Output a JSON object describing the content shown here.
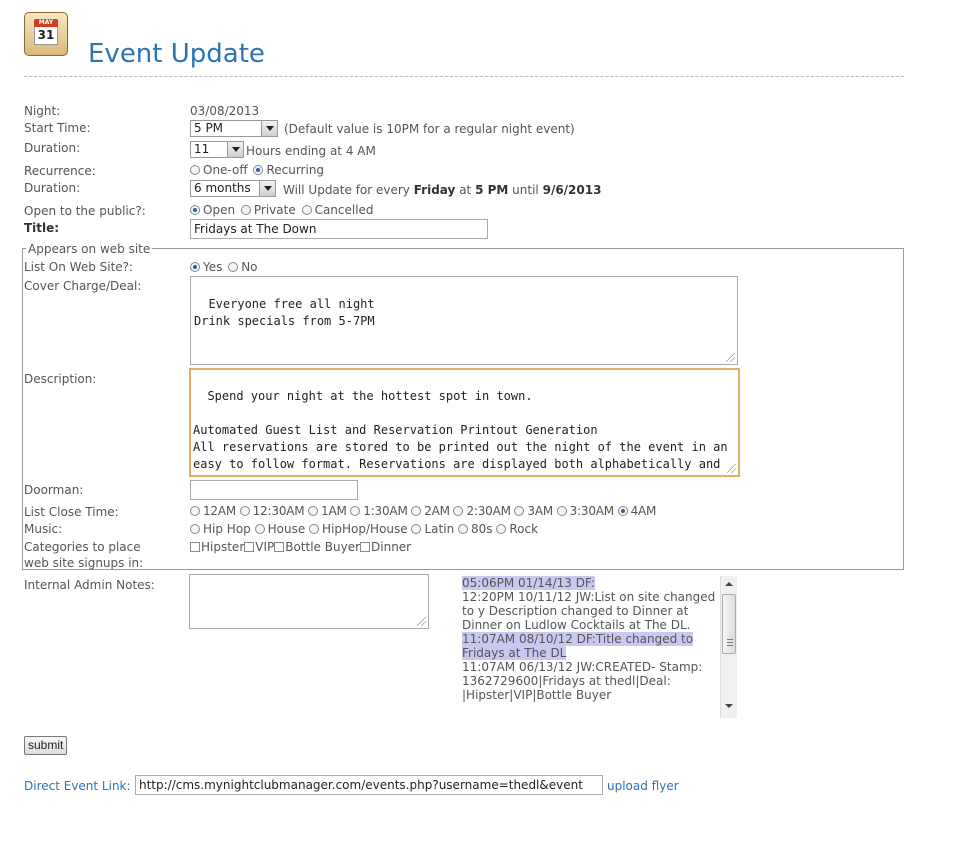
{
  "header": {
    "title": "Event Update",
    "calendar_month": "MAY",
    "calendar_day": "31"
  },
  "fields": {
    "night": {
      "label": "Night:",
      "value": "03/08/2013"
    },
    "start_time": {
      "label": "Start Time:",
      "value": "5 PM",
      "hint": "(Default value is 10PM for a regular night event)"
    },
    "duration_hours": {
      "label": "Duration:",
      "value": "11",
      "hint": "Hours ending at 4 AM"
    },
    "recurrence": {
      "label": "Recurrence:",
      "options": [
        "One-off",
        "Recurring"
      ],
      "selected": "Recurring"
    },
    "duration_period": {
      "label": "Duration:",
      "value": "6 months",
      "hint_prefix": "Will Update for every",
      "day": "Friday",
      "at": "at",
      "time": "5 PM",
      "until": "until",
      "end_date": "9/6/2013"
    },
    "public": {
      "label": "Open to the public?:",
      "options": [
        "Open",
        "Private",
        "Cancelled"
      ],
      "selected": "Open"
    },
    "title": {
      "label": "Title:",
      "value": "Fridays at The Down"
    }
  },
  "web": {
    "legend": "Appears on web site",
    "list_on_site": {
      "label": "List On Web Site?:",
      "options": [
        "Yes",
        "No"
      ],
      "selected": "Yes"
    },
    "cover_charge": {
      "label": "Cover Charge/Deal:",
      "value": "Everyone free all night\nDrink specials from 5-7PM"
    },
    "description": {
      "label": "Description:",
      "value": "Spend your night at the hottest spot in town.\n\nAutomated Guest List and Reservation Printout Generation\nAll reservations are stored to be printed out the night of the event in an easy to follow format. Reservations are displayed both alphabetically and chronologically."
    },
    "doorman": {
      "label": "Doorman:",
      "value": ""
    },
    "list_close": {
      "label": "List Close Time:",
      "options": [
        "12AM",
        "12:30AM",
        "1AM",
        "1:30AM",
        "2AM",
        "2:30AM",
        "3AM",
        "3:30AM",
        "4AM"
      ],
      "selected": "4AM"
    },
    "music": {
      "label": "Music:",
      "options": [
        "Hip Hop",
        "House",
        "HipHop/House",
        "Latin",
        "80s",
        "Rock"
      ]
    },
    "categories": {
      "label_line1": "Categories to place",
      "label_line2": "web site signups in:",
      "options": [
        "Hipster",
        "VIP",
        "Bottle Buyer",
        "Dinner"
      ]
    }
  },
  "admin": {
    "label": "Internal Admin Notes:",
    "notes": [
      {
        "text": "05:06PM 01/14/13 DF:",
        "highlight": true
      },
      {
        "text": "12:20PM 10/11/12 JW:List on site changed to y Description changed to Dinner at Dinner on Ludlow Cocktails at The DL.",
        "highlight": false
      },
      {
        "text": "11:07AM 08/10/12 DF:Title changed to Fridays at The DL",
        "highlight": true
      },
      {
        "text": "11:07AM 06/13/12 JW:CREATED- Stamp: 1362729600|Fridays at thedl|Deal: |Hipster|VIP|Bottle Buyer",
        "highlight": false
      }
    ]
  },
  "actions": {
    "submit": "submit"
  },
  "footer": {
    "link_label": "Direct Event Link:",
    "link_value": "http://cms.mynightclubmanager.com/events.php?username=thedl&event",
    "upload": "upload flyer"
  }
}
